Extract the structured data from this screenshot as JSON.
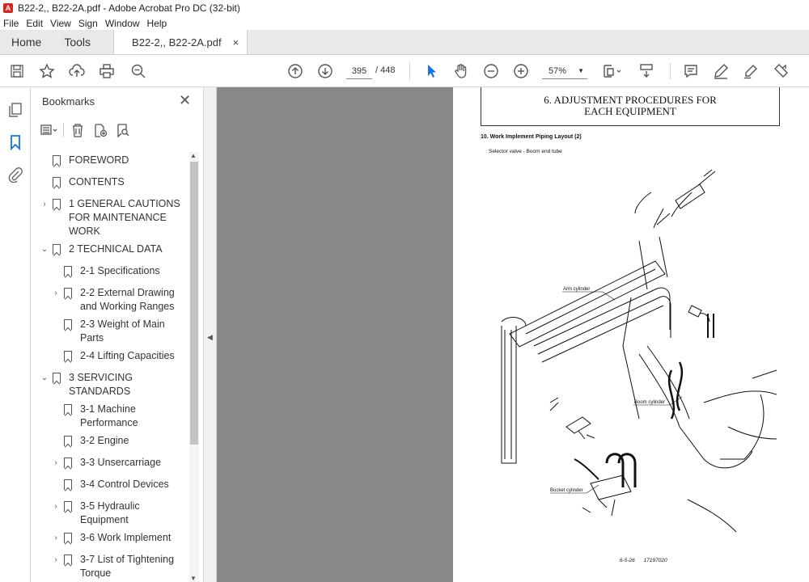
{
  "window": {
    "title": "B22-2,, B22-2A.pdf - Adobe Acrobat Pro DC (32-bit)",
    "app_icon": "pdf-app-icon"
  },
  "menu": [
    "File",
    "Edit",
    "View",
    "Sign",
    "Window",
    "Help"
  ],
  "tabs": {
    "home": "Home",
    "tools": "Tools",
    "document": "B22-2,, B22-2A.pdf",
    "close": "×"
  },
  "toolbar": {
    "page_current": "395",
    "page_total": "/  448",
    "zoom": "57%"
  },
  "bookmarks": {
    "title": "Bookmarks",
    "close": "✕",
    "items": [
      {
        "label": "FOREWORD",
        "expander": ""
      },
      {
        "label": "CONTENTS",
        "expander": ""
      },
      {
        "label": "1 GENERAL CAUTIONS\nFOR MAINTENANCE\nWORK",
        "expander": "›"
      },
      {
        "label": "2 TECHNICAL DATA",
        "expander": "⌄"
      },
      {
        "label": "2-1 Specifications",
        "expander": ""
      },
      {
        "label": "2-2 External Drawing\nand Working Ranges",
        "expander": "›"
      },
      {
        "label": "2-3 Weight of Main\nParts",
        "expander": ""
      },
      {
        "label": "2-4 Lifting Capacities",
        "expander": ""
      },
      {
        "label": "3 SERVICING\nSTANDARDS",
        "expander": "⌄"
      },
      {
        "label": "3-1 Machine\nPerformance",
        "expander": ""
      },
      {
        "label": "3-2 Engine",
        "expander": ""
      },
      {
        "label": "3-3 Unsercarriage",
        "expander": "›"
      },
      {
        "label": "3-4 Control Devices",
        "expander": ""
      },
      {
        "label": "3-5 Hydraulic\nEquipment",
        "expander": "›"
      },
      {
        "label": "3-6 Work Implement",
        "expander": "›"
      },
      {
        "label": "3-7 List of Tightening\nTorque",
        "expander": "›"
      }
    ]
  },
  "document": {
    "header_line1": "6. ADJUSTMENT PROCEDURES FOR",
    "header_line2": "EACH EQUIPMENT",
    "heading": "10. Work Implement Piping Layout (2)",
    "subheading": "Selector valve - Boom end tube",
    "label_arm": "Arm cylinder",
    "label_boom": "Boom cylinder",
    "label_bucket": "Bucket cylinder",
    "footer_page": "6-5-26",
    "footer_code": "17197020"
  },
  "colors": {
    "accent": "#1473e6",
    "doc_background": "#888888",
    "app_red": "#d9261c"
  }
}
